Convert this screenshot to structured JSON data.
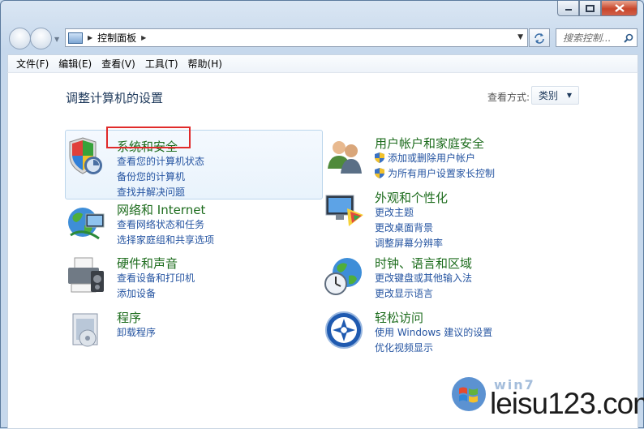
{
  "window": {
    "caption_buttons": {
      "minimize_icon": "minimize-icon",
      "maximize_icon": "maximize-icon",
      "close_icon": "close-icon"
    }
  },
  "nav": {
    "address_path": "控制面板",
    "search_placeholder": "搜索控制..."
  },
  "menu": [
    "文件(F)",
    "编辑(E)",
    "查看(V)",
    "工具(T)",
    "帮助(H)"
  ],
  "content": {
    "title": "调整计算机的设置",
    "view_by_label": "查看方式:",
    "view_by_value": "类别"
  },
  "categories": {
    "system_security": {
      "title": "系统和安全",
      "links": [
        "查看您的计算机状态",
        "备份您的计算机",
        "查找并解决问题"
      ]
    },
    "network": {
      "title": "网络和 Internet",
      "links": [
        "查看网络状态和任务",
        "选择家庭组和共享选项"
      ]
    },
    "hardware": {
      "title": "硬件和声音",
      "links": [
        "查看设备和打印机",
        "添加设备"
      ]
    },
    "programs": {
      "title": "程序",
      "links": [
        "卸载程序"
      ]
    },
    "user_accounts": {
      "title": "用户帐户和家庭安全",
      "links": [
        "添加或删除用户帐户",
        "为所有用户设置家长控制"
      ]
    },
    "appearance": {
      "title": "外观和个性化",
      "links": [
        "更改主题",
        "更改桌面背景",
        "调整屏幕分辨率"
      ]
    },
    "clock": {
      "title": "时钟、语言和区域",
      "links": [
        "更改键盘或其他输入法",
        "更改显示语言"
      ]
    },
    "ease": {
      "title": "轻松访问",
      "links": [
        "使用 Windows 建议的设置",
        "优化视频显示"
      ]
    }
  },
  "watermark": {
    "top_text": "win7",
    "site": "leisu123.com"
  },
  "colors": {
    "category_title": "#1d6c1d",
    "link": "#2554a1",
    "highlight_border": "#e02a2a"
  }
}
